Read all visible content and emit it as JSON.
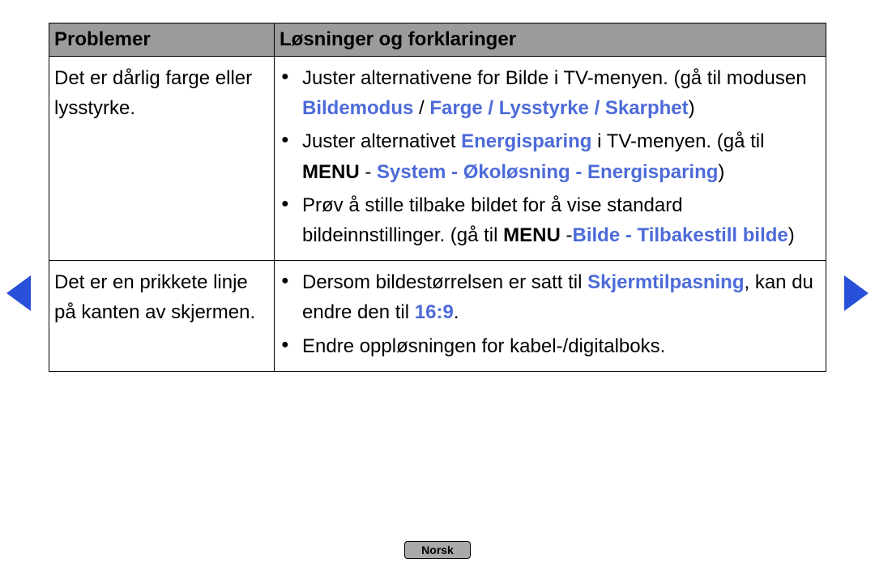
{
  "header": {
    "col1": "Problemer",
    "col2": "Løsninger og forklaringer"
  },
  "rows": [
    {
      "problem": "Det er dårlig farge eller lysstyrke.",
      "solutions": [
        {
          "parts": [
            {
              "text": "Juster alternativene for Bilde i TV-menyen. (gå til modusen "
            },
            {
              "text": "Bildemodus",
              "blue": true,
              "bold": true
            },
            {
              "text": " / "
            },
            {
              "text": "Farge / Lysstyrke / Skarphet",
              "blue": true,
              "bold": true
            },
            {
              "text": ")"
            }
          ]
        },
        {
          "parts": [
            {
              "text": "Juster alternativet "
            },
            {
              "text": "Energisparing",
              "blue": true,
              "bold": true
            },
            {
              "text": " i TV-menyen. (gå til "
            },
            {
              "text": "MENU",
              "bold": true
            },
            {
              "text": " - "
            },
            {
              "text": "System - Økoløsning - Energisparing",
              "blue": true,
              "bold": true
            },
            {
              "text": ")"
            }
          ]
        },
        {
          "parts": [
            {
              "text": "Prøv å stille tilbake bildet for å vise standard bildeinnstillinger. (gå til "
            },
            {
              "text": "MENU",
              "bold": true
            },
            {
              "text": " -"
            },
            {
              "text": "Bilde - Tilbakestill bilde",
              "blue": true,
              "bold": true
            },
            {
              "text": ")"
            }
          ]
        }
      ]
    },
    {
      "problem": "Det er en prikkete linje på kanten av skjermen.",
      "solutions": [
        {
          "parts": [
            {
              "text": "Dersom bildestørrelsen er satt til "
            },
            {
              "text": "Skjermtilpasning",
              "blue": true,
              "bold": true
            },
            {
              "text": ", kan du endre den til "
            },
            {
              "text": "16:9",
              "blue": true,
              "bold": true
            },
            {
              "text": "."
            }
          ]
        },
        {
          "parts": [
            {
              "text": "Endre oppløsningen for kabel-/digitalboks."
            }
          ]
        }
      ]
    }
  ],
  "footer": {
    "language": "Norsk"
  }
}
